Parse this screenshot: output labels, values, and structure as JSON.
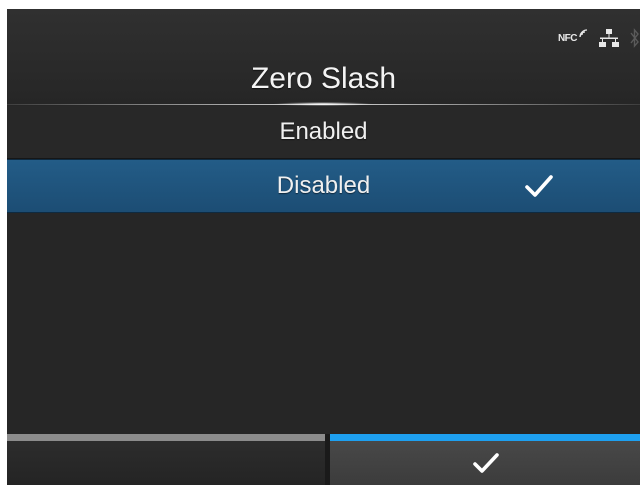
{
  "header": {
    "title": "Zero Slash",
    "status_icons": {
      "nfc_label": "NFC",
      "icons": [
        "nfc-icon",
        "network-icon",
        "bluetooth-icon"
      ]
    }
  },
  "options": [
    {
      "label": "Enabled",
      "selected": false
    },
    {
      "label": "Disabled",
      "selected": true,
      "icon": "checkmark-icon"
    }
  ],
  "softkeys": {
    "left": {
      "label": "",
      "indicator_color": "#8c8c8c"
    },
    "right": {
      "icon": "checkmark-icon",
      "indicator_color": "#1ea0f0"
    }
  },
  "colors": {
    "background": "#262626",
    "selected_row": "#1f5580",
    "accent": "#1ea0f0",
    "text": "#f0f0f0"
  }
}
